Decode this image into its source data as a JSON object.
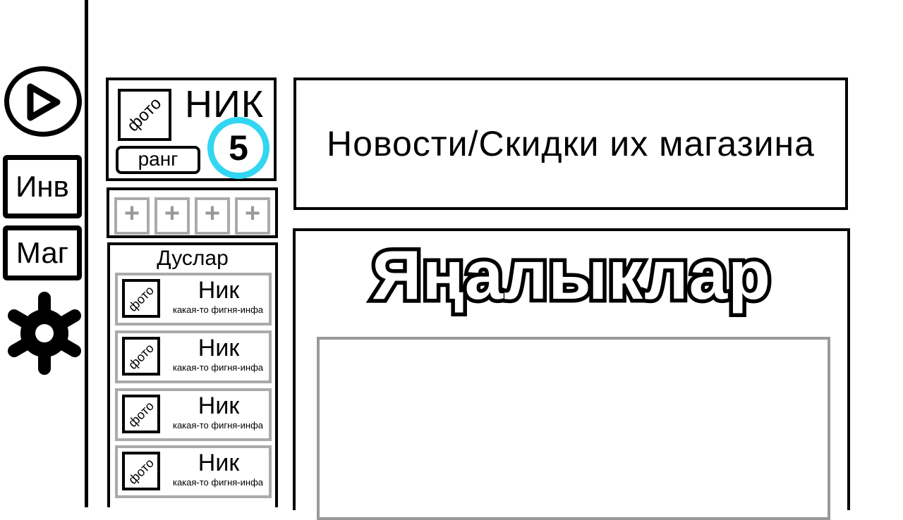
{
  "rail": {
    "play_icon": "play-icon",
    "inventory_label": "Инв",
    "shop_label": "Маг",
    "settings_icon": "gear-icon"
  },
  "profile": {
    "photo_label": "фото",
    "nickname": "НИК",
    "rank_label": "ранг",
    "level": "5",
    "level_ring_color": "#33d6f0"
  },
  "slots": [
    {
      "label": "+"
    },
    {
      "label": "+"
    },
    {
      "label": "+"
    },
    {
      "label": "+"
    }
  ],
  "friends": {
    "title": "Дуслар",
    "items": [
      {
        "photo_label": "фото",
        "nick": "Ник",
        "info": "какая-то фигня-инфа"
      },
      {
        "photo_label": "фото",
        "nick": "Ник",
        "info": "какая-то фигня-инфа"
      },
      {
        "photo_label": "фото",
        "nick": "Ник",
        "info": "какая-то фигня-инфа"
      },
      {
        "photo_label": "фото",
        "nick": "Ник",
        "info": "какая-то фигня-инфа"
      }
    ]
  },
  "news_banner": {
    "text": "Новости/Скидки их магазина"
  },
  "news_panel": {
    "heading": "Яңалыклар"
  }
}
